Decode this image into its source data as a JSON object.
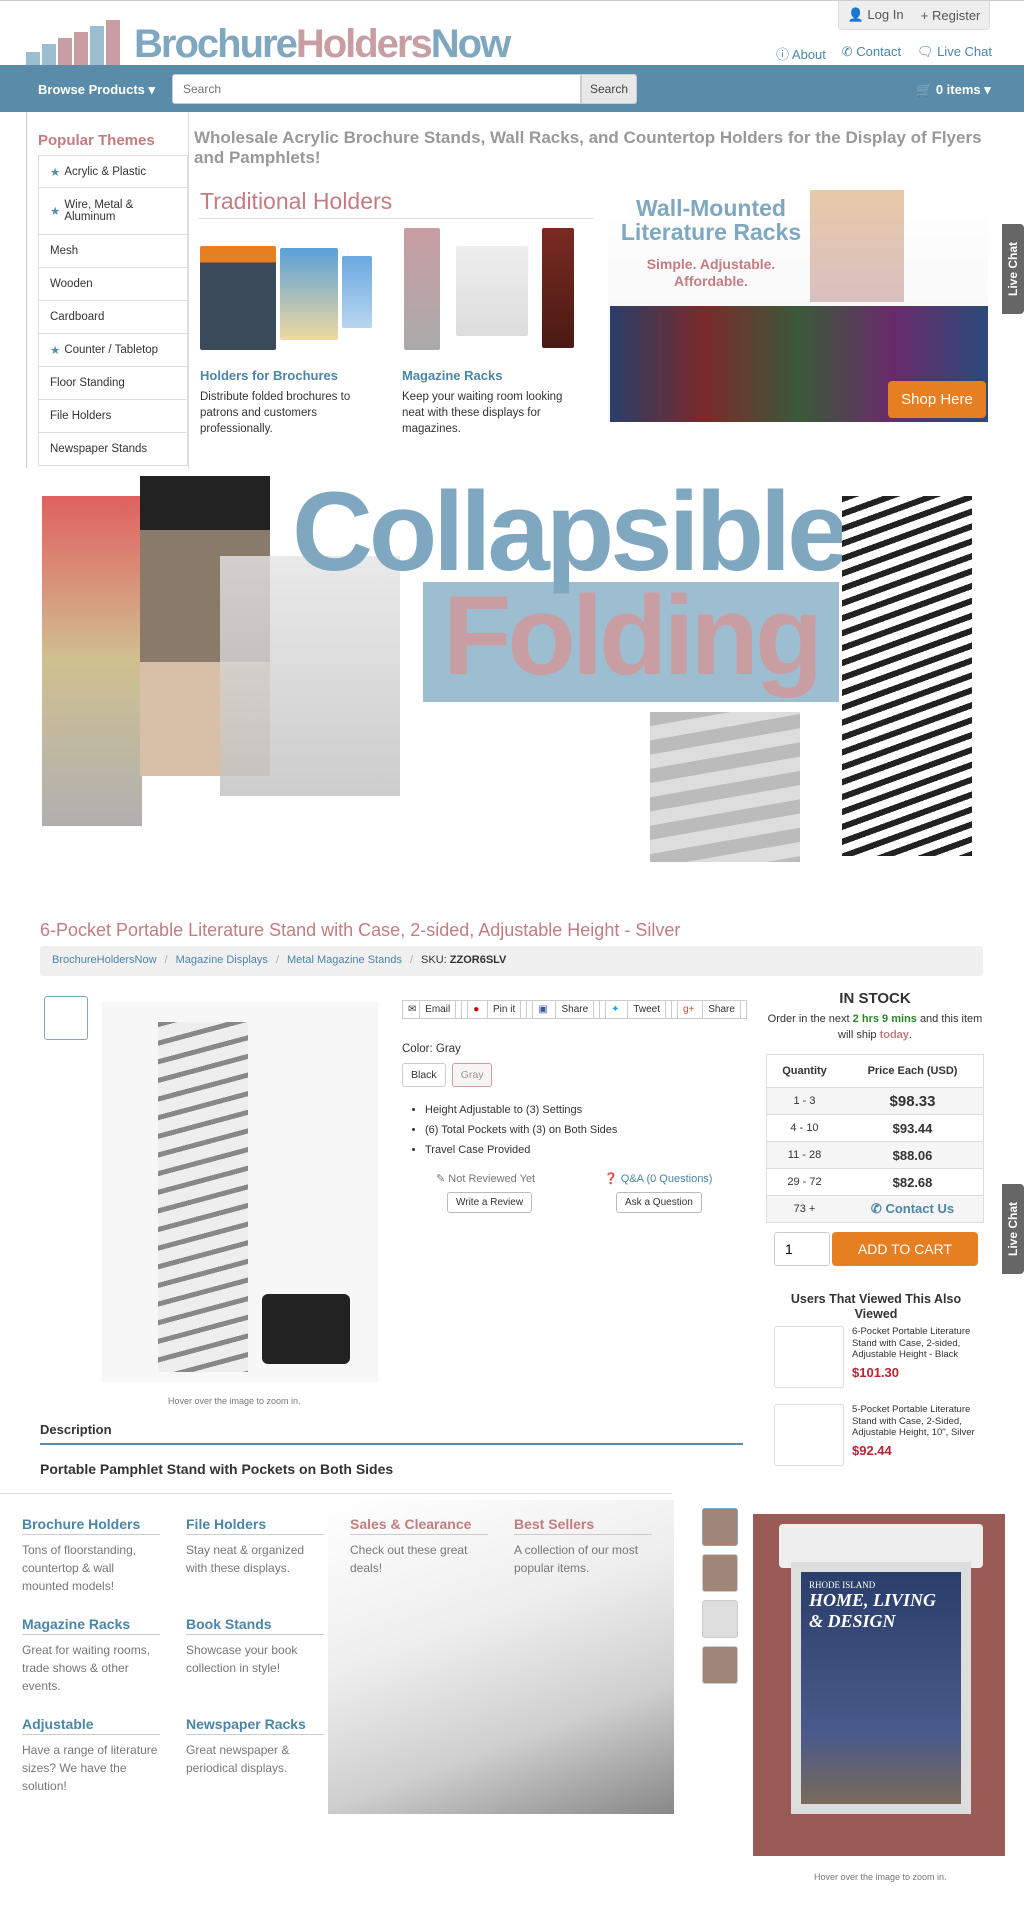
{
  "header": {
    "login": "Log In",
    "register": "Register",
    "logo": {
      "part1": "Brochure",
      "part2": "Holders",
      "part3": "Now"
    },
    "links": [
      {
        "icon": "info-icon",
        "label": "About"
      },
      {
        "icon": "phone-icon",
        "label": "Contact"
      },
      {
        "icon": "chat-icon",
        "label": "Live Chat"
      }
    ]
  },
  "nav": {
    "browse": "Browse Products",
    "search_placeholder": "Search",
    "search_button": "Search",
    "cart": "0 items"
  },
  "sidebar": {
    "title": "Popular Themes",
    "items": [
      {
        "label": "Acrylic & Plastic",
        "star": true
      },
      {
        "label": "Wire, Metal & Aluminum",
        "star": true
      },
      {
        "label": "Mesh",
        "star": false
      },
      {
        "label": "Wooden",
        "star": false
      },
      {
        "label": "Cardboard",
        "star": false
      },
      {
        "label": "Counter / Tabletop",
        "star": true
      },
      {
        "label": "Floor Standing",
        "star": false
      },
      {
        "label": "File Holders",
        "star": false
      },
      {
        "label": "Newspaper Stands",
        "star": false
      }
    ]
  },
  "main": {
    "heading": "Wholesale Acrylic Brochure Stands, Wall Racks, and Countertop Holders for the Display of Flyers and Pamphlets!",
    "traditional": "Traditional Holders",
    "cols": [
      {
        "title": "Holders for Brochures",
        "desc": "Distribute folded brochures to patrons and customers professionally."
      },
      {
        "title": "Magazine Racks",
        "desc": "Keep your waiting room looking neat with these displays for magazines."
      }
    ],
    "wall": {
      "title": "Wall-Mounted Literature Racks",
      "subtitle": "Simple. Adjustable. Affordable.",
      "button": "Shop Here"
    }
  },
  "livechat": "Live Chat",
  "banner": {
    "line1": "Collapsible",
    "line2": "Folding"
  },
  "product": {
    "title": "6-Pocket Portable Literature Stand with Case, 2-sided, Adjustable Height - Silver",
    "breadcrumb": [
      "BrochureHoldersNow",
      "Magazine Displays",
      "Metal Magazine Stands"
    ],
    "sku_label": "SKU:",
    "sku": "ZZOR6SLV",
    "hover": "Hover over the image to zoom in.",
    "share": [
      "Email",
      "Pin it",
      "Share",
      "Tweet",
      "Share"
    ],
    "color_label": "Color: Gray",
    "colors": [
      "Black",
      "Gray"
    ],
    "features": [
      "Height Adjustable to (3) Settings",
      "(6) Total Pockets with (3) on Both Sides",
      "Travel Case Provided"
    ],
    "not_reviewed": "Not Reviewed Yet",
    "qa": "Q&A (0 Questions)",
    "write_review": "Write a Review",
    "ask_question": "Ask a Question",
    "stock": {
      "title": "IN STOCK",
      "text1": "Order in the next",
      "time": "2 hrs 9 mins",
      "text2": "and this item will ship",
      "today": "today",
      "period": "."
    },
    "price_table": {
      "headers": [
        "Quantity",
        "Price Each (USD)"
      ],
      "rows": [
        [
          "1 - 3",
          "$98.33"
        ],
        [
          "4 - 10",
          "$93.44"
        ],
        [
          "11 - 28",
          "$88.06"
        ],
        [
          "29 - 72",
          "$82.68"
        ],
        [
          "73 +",
          "Contact Us"
        ]
      ]
    },
    "qty": "1",
    "add_to_cart": "ADD TO CART",
    "also_title": "Users That Viewed This Also Viewed",
    "also": [
      {
        "name": "6-Pocket Portable Literature Stand with Case, 2-sided, Adjustable Height - Black",
        "price": "$101.30"
      },
      {
        "name": "5-Pocket Portable Literature Stand with Case, 2-Sided, Adjustable Height, 10\", Silver",
        "price": "$92.44"
      }
    ],
    "description_tab": "Description",
    "description_title": "Portable Pamphlet Stand with Pockets on Both Sides"
  },
  "bottom": {
    "cats": [
      {
        "title": "Brochure Holders",
        "desc": "Tons of floorstanding, countertop & wall mounted models!",
        "red": false
      },
      {
        "title": "File Holders",
        "desc": "Stay neat & organized with these displays.",
        "red": false
      },
      {
        "title": "Sales & Clearance",
        "desc": "Check out these great deals!",
        "red": true
      },
      {
        "title": "Best Sellers",
        "desc": "A collection of our most popular items.",
        "red": true
      },
      {
        "title": "Magazine Racks",
        "desc": "Great for waiting rooms, trade shows & other events.",
        "red": false
      },
      {
        "title": "Book Stands",
        "desc": "Showcase your book collection in style!",
        "red": false
      },
      {
        "title": "Adjustable",
        "desc": "Have a range of literature sizes? We have the solution!",
        "red": false
      },
      {
        "title": "Newspaper Racks",
        "desc": "Great newspaper & periodical displays.",
        "red": false
      }
    ],
    "magazine": {
      "l1": "RHODE ISLAND",
      "l2": "HOME, LIVING",
      "l3": "& DESIGN"
    },
    "hover": "Hover over the image to zoom in."
  }
}
